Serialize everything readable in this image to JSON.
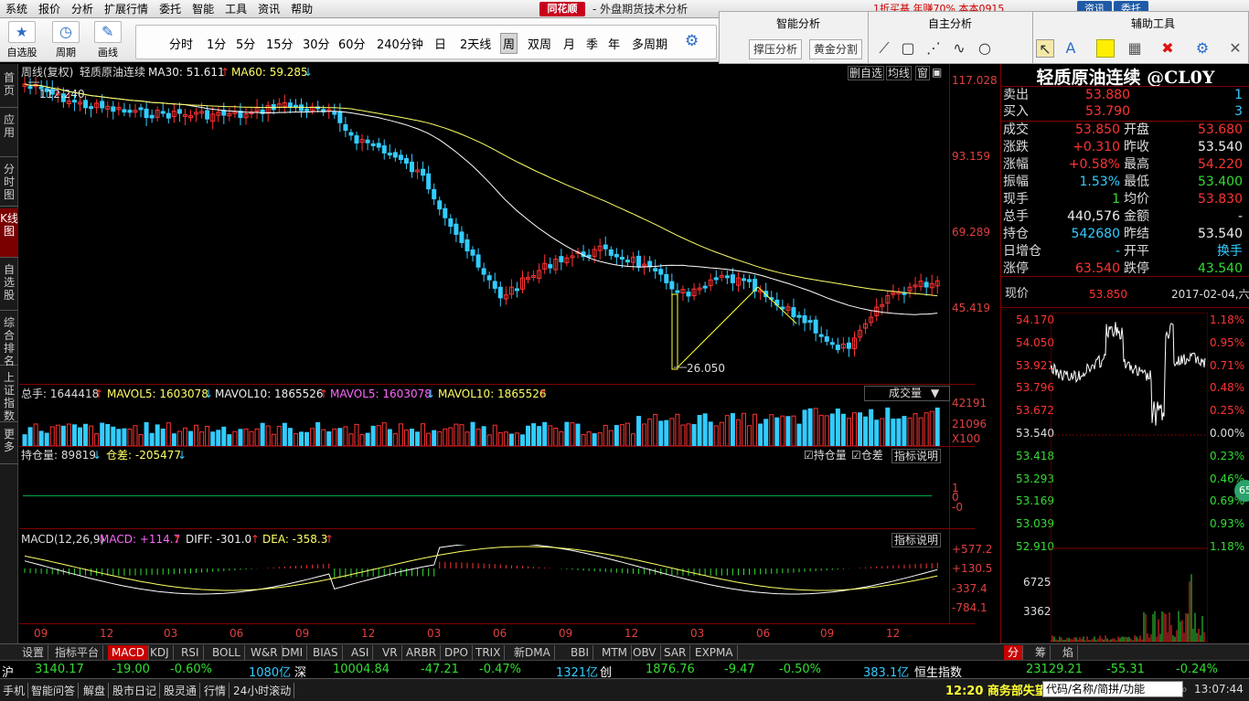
{
  "menubar": {
    "items": [
      "系统",
      "报价",
      "分析",
      "扩展行情",
      "委托",
      "智能",
      "工具",
      "资讯",
      "帮助"
    ],
    "brand": "同花顺",
    "title": "- 外盘期货技术分析",
    "promo": "1折买基 年赚70%  本本0915",
    "btn1": "资讯",
    "btn2": "委托"
  },
  "toolbar": {
    "big": [
      {
        "label": "自选股",
        "icon": "star-icon"
      },
      {
        "label": "周期",
        "icon": "clock-icon"
      },
      {
        "label": "画线",
        "icon": "pen-icon"
      }
    ],
    "periods": [
      "分时",
      "1分",
      "5分",
      "15分",
      "30分",
      "60分",
      "240分钟",
      "日",
      "2天线",
      "周",
      "双周",
      "月",
      "季",
      "年",
      "多周期"
    ],
    "active_period": "周"
  },
  "panels": {
    "smart": "智能分析",
    "self": "自主分析",
    "tools": "辅助工具",
    "btn_pressure": "撑压分析",
    "btn_gold": "黄金分割"
  },
  "lefttabs": [
    "首页",
    "应用",
    "分时图",
    "K线图",
    "自选股",
    "综合排名",
    "上证指数",
    "更多"
  ],
  "chart": {
    "header": {
      "period": "周线(复权)",
      "name": "轻质原油连续",
      "ma30": "MA30: 51.611",
      "ma60": "MA60: 59.285",
      "btns": [
        "删自选",
        "均线",
        "窗"
      ]
    },
    "price_axis": [
      "117.028",
      "93.159",
      "69.289",
      "45.419"
    ],
    "high_label": "112.240",
    "low_label": "26.050",
    "vol_header": {
      "total": "总手: 1644418",
      "mavol5": "MAVOL5: 1603078",
      "mavol10": "MAVOL10: 1865526",
      "mavol5b": "MAVOL5: 1603078",
      "mavol10b": "MAVOL10: 1865526",
      "dropdown": "成交量"
    },
    "vol_axis": [
      "42191",
      "21096",
      "X100"
    ],
    "oi_header": {
      "oi": "持仓量: 89819",
      "diff": "仓差: -205477",
      "chk1": "持仓量",
      "chk2": "仓差",
      "explain": "指标说明"
    },
    "oi_axis": [
      "1",
      "0",
      "-0"
    ],
    "macd_header": {
      "name": "MACD(12,26,9)",
      "macd": "MACD: +114.7",
      "diff": "DIFF: -301.0",
      "dea": "DEA: -358.3",
      "explain": "指标说明"
    },
    "macd_axis": [
      "+577.2",
      "+130.5",
      "-337.4",
      "-784.1"
    ],
    "x_axis": [
      "09",
      "12",
      "03",
      "06",
      "09",
      "12",
      "03",
      "06",
      "09",
      "12",
      "03",
      "06",
      "09",
      "12"
    ]
  },
  "quote": {
    "title": "轻质原油连续 @CL0Y",
    "rows": [
      {
        "l": "卖出",
        "v": "53.880",
        "r": "1",
        "lc": "#dddddd",
        "vc": "#ff3333",
        "rc": "#33ccff"
      },
      {
        "l": "买入",
        "v": "53.790",
        "r": "3",
        "lc": "#dddddd",
        "vc": "#ff3333",
        "rc": "#33ccff"
      }
    ],
    "grid": [
      {
        "l1": "成交",
        "v1": "53.850",
        "l2": "开盘",
        "v2": "53.680",
        "c1": "#ff3333",
        "c2": "#ff3333"
      },
      {
        "l1": "涨跌",
        "v1": "+0.310",
        "l2": "昨收",
        "v2": "53.540",
        "c1": "#ff3333",
        "c2": "#eeeeee"
      },
      {
        "l1": "涨幅",
        "v1": "+0.58%",
        "l2": "最高",
        "v2": "54.220",
        "c1": "#ff3333",
        "c2": "#ff3333"
      },
      {
        "l1": "振幅",
        "v1": "1.53%",
        "l2": "最低",
        "v2": "53.400",
        "c1": "#33ccff",
        "c2": "#33dd33"
      },
      {
        "l1": "现手",
        "v1": "1",
        "l2": "均价",
        "v2": "53.830",
        "c1": "#33dd33",
        "c2": "#ff3333"
      },
      {
        "l1": "总手",
        "v1": "440,576",
        "l2": "金额",
        "v2": "-",
        "c1": "#eeeeee",
        "c2": "#eeeeee"
      },
      {
        "l1": "持仓",
        "v1": "542680",
        "l2": "昨结",
        "v2": "53.540",
        "c1": "#33ccff",
        "c2": "#eeeeee"
      },
      {
        "l1": "日增仓",
        "v1": "-",
        "l2": "开平",
        "v2": "换手",
        "c1": "#33ccff",
        "c2": "#33ccff"
      },
      {
        "l1": "涨停",
        "v1": "63.540",
        "l2": "跌停",
        "v2": "43.540",
        "c1": "#ff3333",
        "c2": "#33dd33"
      }
    ],
    "now_label": "现价",
    "now_value": "53.850",
    "date": "2017-02-04,六",
    "left_axis": [
      "54.170",
      "54.050",
      "53.921",
      "53.796",
      "53.672",
      "53.540",
      "53.418",
      "53.293",
      "53.169",
      "53.039",
      "52.910"
    ],
    "right_axis": [
      "1.18%",
      "0.95%",
      "0.71%",
      "0.48%",
      "0.25%",
      "0.00%",
      "0.23%",
      "0.46%",
      "0.69%",
      "0.93%",
      "1.18%"
    ],
    "vol_axis": [
      "6725",
      "3362"
    ],
    "badge": "65"
  },
  "bottomtabs": [
    "设置",
    "指标平台",
    "MACD",
    "KDJ",
    "RSI",
    "BOLL",
    "W&R",
    "DMI",
    "BIAS",
    "ASI",
    "VR",
    "ARBR",
    "DPO",
    "TRIX",
    "新DMA",
    "BBI",
    "MTM",
    "OBV",
    "SAR",
    "EXPMA"
  ],
  "active_bottomtab": "MACD",
  "rtabs": [
    "分",
    "筹",
    "焰"
  ],
  "ticker": [
    {
      "t": "沪",
      "c": "#ffffff"
    },
    {
      "t": "3140.17",
      "c": "#33dd33"
    },
    {
      "t": "-19.00",
      "c": "#33dd33"
    },
    {
      "t": "-0.60%",
      "c": "#33dd33"
    },
    {
      "t": "1080亿",
      "c": "#33ccff"
    },
    {
      "t": "深",
      "c": "#ffffff"
    },
    {
      "t": "10004.84",
      "c": "#33dd33"
    },
    {
      "t": "-47.21",
      "c": "#33dd33"
    },
    {
      "t": "-0.47%",
      "c": "#33dd33"
    },
    {
      "t": "1321亿",
      "c": "#33ccff"
    },
    {
      "t": "创",
      "c": "#ffffff"
    },
    {
      "t": "1876.76",
      "c": "#33dd33"
    },
    {
      "t": "-9.47",
      "c": "#33dd33"
    },
    {
      "t": "-0.50%",
      "c": "#33dd33"
    },
    {
      "t": "383.1亿",
      "c": "#33ccff"
    },
    {
      "t": "恒生指数",
      "c": "#ffffff"
    },
    {
      "t": "23129.21",
      "c": "#33dd33"
    },
    {
      "t": "-55.31",
      "c": "#33dd33"
    },
    {
      "t": "-0.24%",
      "c": "#33dd33"
    }
  ],
  "statusbar": {
    "items": [
      "手机",
      "智能问答",
      "解盘",
      "股市日记",
      "股灵通",
      "行情",
      "24小时滚动"
    ],
    "news": "12:20 商务部失望",
    "search": "代码/名称/简拼/功能",
    "time": "13:07:44"
  }
}
